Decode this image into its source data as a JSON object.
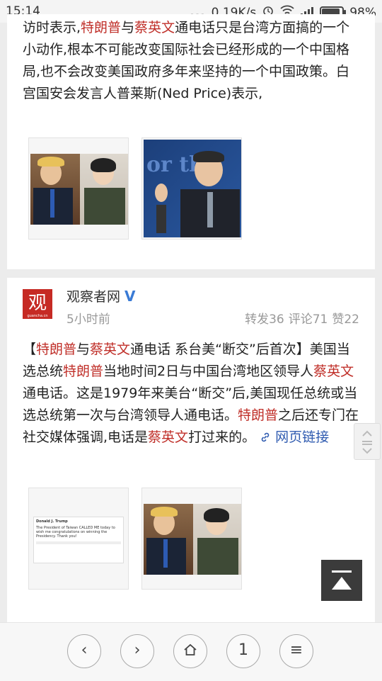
{
  "status_bar": {
    "time": "15:14",
    "dots": "...",
    "network_speed": "0.19K/s",
    "alarm_icon": "alarm-icon",
    "wifi_icon": "wifi-icon",
    "signal_icon": "signal-icon",
    "battery": "98%",
    "battery_level": 0.98
  },
  "post1": {
    "text_parts": [
      "访时表示,",
      "特朗普",
      "与",
      "蔡英文",
      "通电话只是台湾方面搞的一个小动作,根本不可能改变国际社会已经形成的一个中国格局,也不会改变美国政府多年来坚持的一个中国政策。白宫国安会发言人普莱斯(Ned Price)表示,"
    ]
  },
  "post2": {
    "author": "观察者网",
    "verified_mark": "V",
    "logo_char": "观",
    "logo_sub": "guancha.cn",
    "time_ago": "5小时前",
    "reposts": "转发36",
    "comments": "评论71",
    "likes": "赞22",
    "text_parts": [
      "【",
      "特朗普",
      "与",
      "蔡英文",
      "通电话 系台美“断交”后首次】美国当选总统",
      "特朗普",
      "当地时间2日与中国台湾地区领导人",
      "蔡英文",
      "通电话。这是1979年来美台“断交”后,美国现任总统或当选总统第一次与台湾领导人通电话。",
      "特朗普",
      "之后还专门在社交媒体强调,电话是",
      "蔡英文",
      "打过来的。"
    ],
    "link_text": "网页链接",
    "tweet_author": "Donald J. Trump",
    "tweet_text": "The President of Taiwan CALLED ME today to wish me congratulations on winning the Presidency. Thank you!"
  },
  "nav": {
    "back": "‹",
    "forward": "›",
    "home_icon": "home-icon",
    "tabs": "1",
    "menu": "≡"
  },
  "colors": {
    "highlight": "#c0302a",
    "link": "#2f5bb0",
    "brand_red": "#c62a24"
  }
}
